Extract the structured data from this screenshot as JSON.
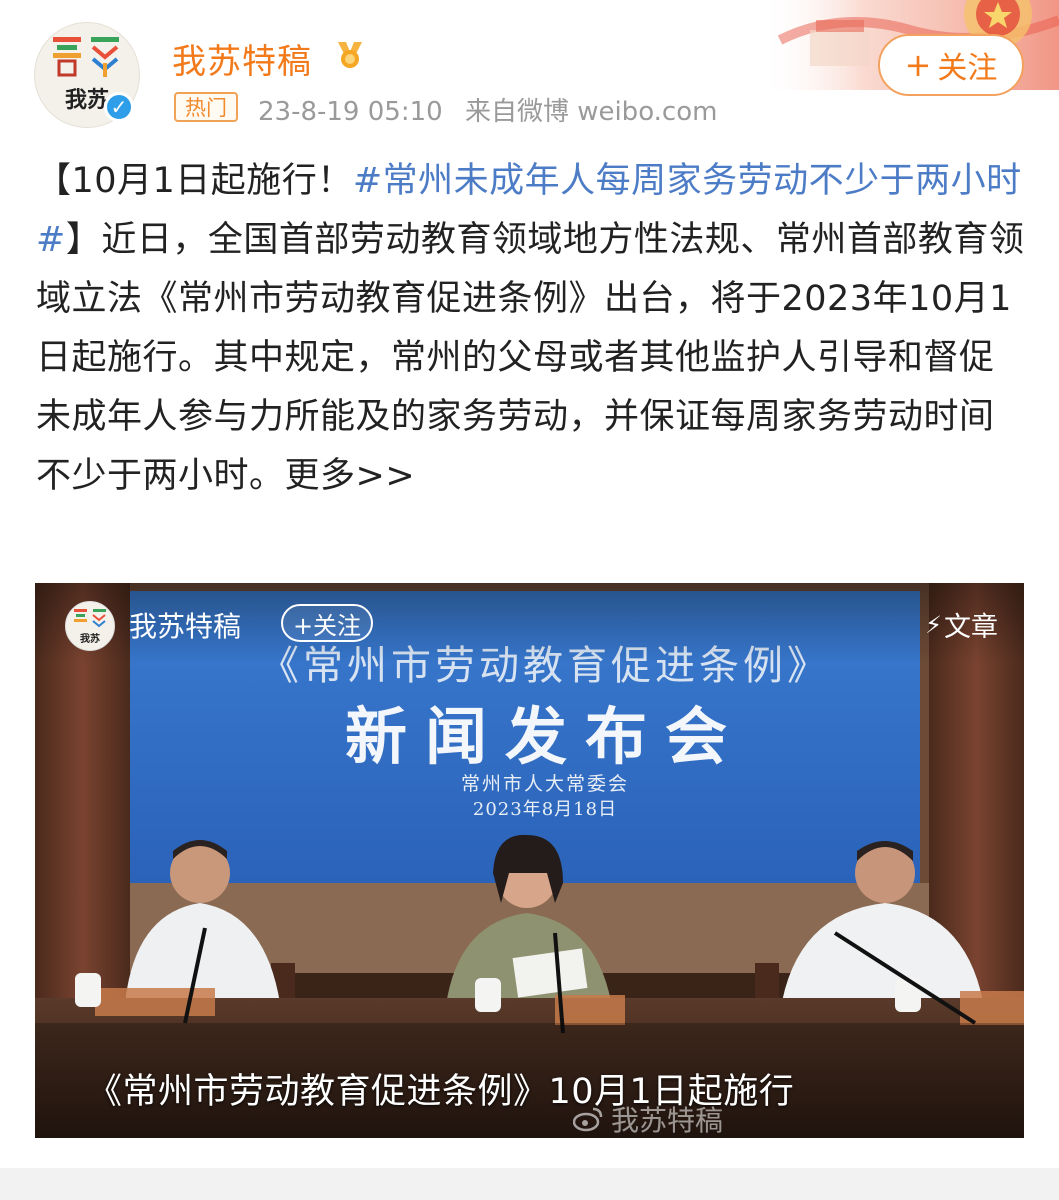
{
  "header": {
    "username": "我苏特稿",
    "hot_tag": "热门",
    "time": "23-8-19 05:10",
    "source": "来自微博 weibo.com",
    "follow_label": "关注",
    "avatar_text": "我苏"
  },
  "post": {
    "title_prefix": "【10月1日起施行！",
    "hashtag": "#常州未成年人每周家务劳动不少于两小时#",
    "title_suffix": "】",
    "body": "近日，全国首部劳动教育领域地方性法规、常州首部教育领域立法《常州市劳动教育促进条例》出台，将于2023年10月1日起施行。其中规定，常州的父母或者其他监护人引导和督促未成年人参与力所能及的家务劳动，并保证每周家务劳动时间不少于两小时。",
    "more": "更多>>"
  },
  "video": {
    "username": "我苏特稿",
    "follow_label": "+关注",
    "article_label": "文章",
    "avatar_text": "我苏",
    "banner_title": "《常州市劳动教育促进条例》",
    "banner_main": "新闻发布会",
    "banner_org": "常州市人大常委会",
    "banner_date": "2023年8月18日",
    "caption": "《常州市劳动教育促进条例》10月1日起施行",
    "watermark": "我苏特稿"
  },
  "colors": {
    "brand_orange": "#f27a1b",
    "hashtag_blue": "#4d7cc7",
    "verified_blue": "#2f9ee8",
    "banner_blue": "#2f6fc4"
  }
}
